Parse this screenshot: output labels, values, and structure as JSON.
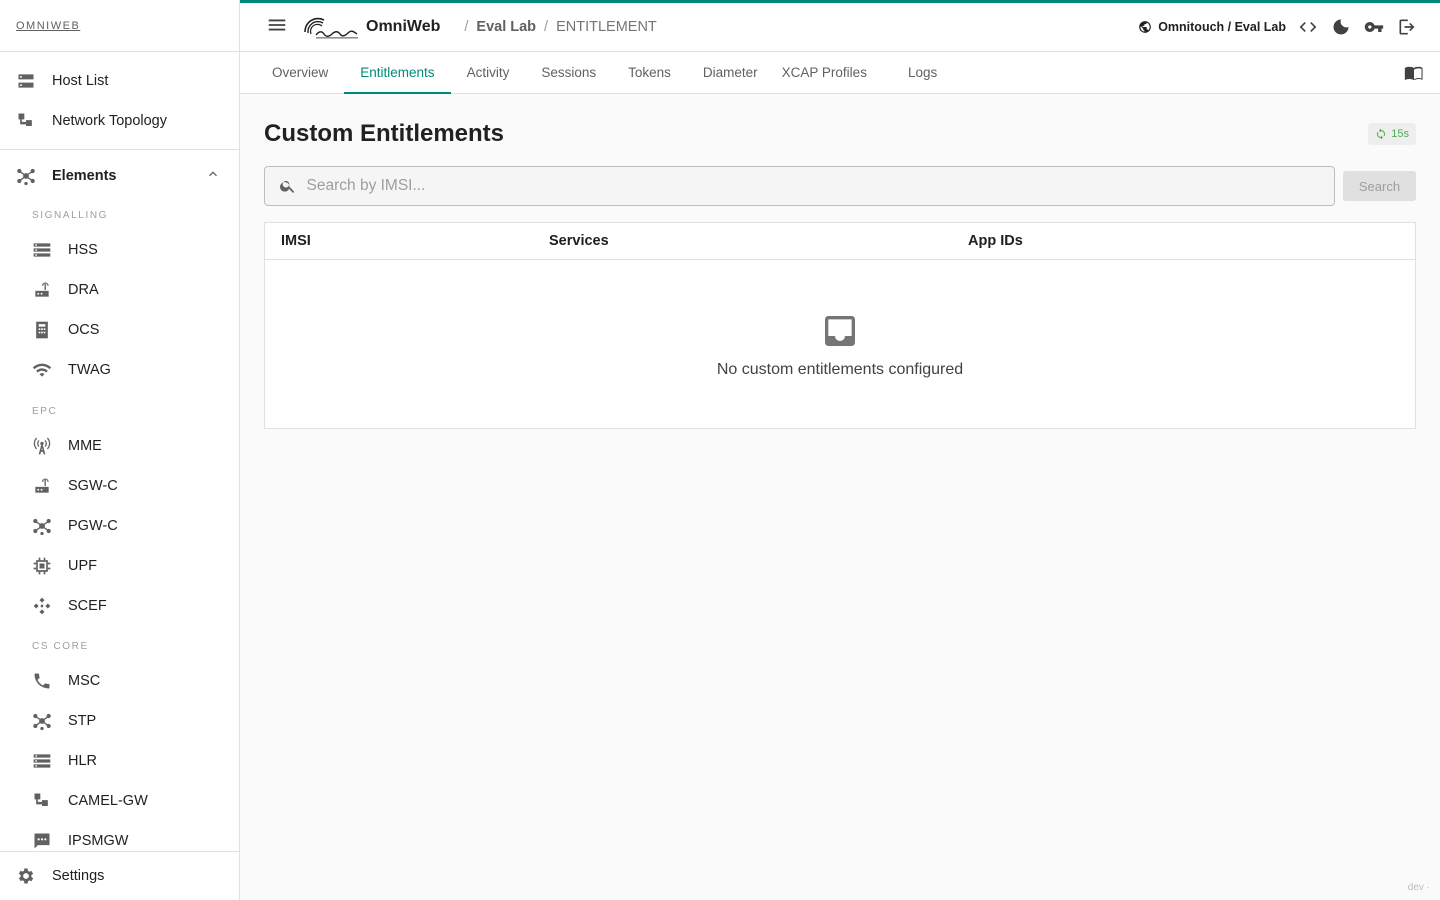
{
  "brand": {
    "name": "OMNIWEB"
  },
  "sidebar": {
    "top_items": [
      {
        "label": "Host List",
        "icon": "server-list-icon"
      },
      {
        "label": "Network Topology",
        "icon": "topology-icon"
      }
    ],
    "elements_label": "Elements",
    "sections": [
      {
        "title": "SIGNALLING",
        "items": [
          "HSS",
          "DRA",
          "OCS",
          "TWAG"
        ]
      },
      {
        "title": "EPC",
        "items": [
          "MME",
          "SGW-C",
          "PGW-C",
          "UPF",
          "SCEF"
        ]
      },
      {
        "title": "CS CORE",
        "items": [
          "MSC",
          "STP",
          "HLR",
          "CAMEL-GW",
          "IPSMGW"
        ]
      }
    ],
    "settings_label": "Settings"
  },
  "topbar": {
    "app_name": "OmniWeb",
    "breadcrumb": {
      "lab": "Eval Lab",
      "current": "ENTITLEMENT",
      "separator": "/"
    },
    "tenant": "Omnitouch / Eval Lab"
  },
  "tabs": [
    {
      "label": "Overview",
      "active": false
    },
    {
      "label": "Entitlements",
      "active": true
    },
    {
      "label": "Activity",
      "active": false
    },
    {
      "label": "Sessions",
      "active": false
    },
    {
      "label": "Tokens",
      "active": false
    },
    {
      "label": "Diameter",
      "active": false
    },
    {
      "label": "XCAP Profiles",
      "active": false
    },
    {
      "label": "Logs",
      "active": false
    }
  ],
  "main": {
    "title": "Custom Entitlements",
    "refresh": "15s",
    "search": {
      "placeholder": "Search by IMSI...",
      "value": "",
      "button": "Search"
    },
    "table": {
      "columns": [
        "IMSI",
        "Services",
        "App IDs"
      ],
      "empty_message": "No custom entitlements configured"
    }
  },
  "footer": {
    "env": "dev ·"
  },
  "colors": {
    "accent": "#00897b",
    "refresh": "#4caf50"
  }
}
